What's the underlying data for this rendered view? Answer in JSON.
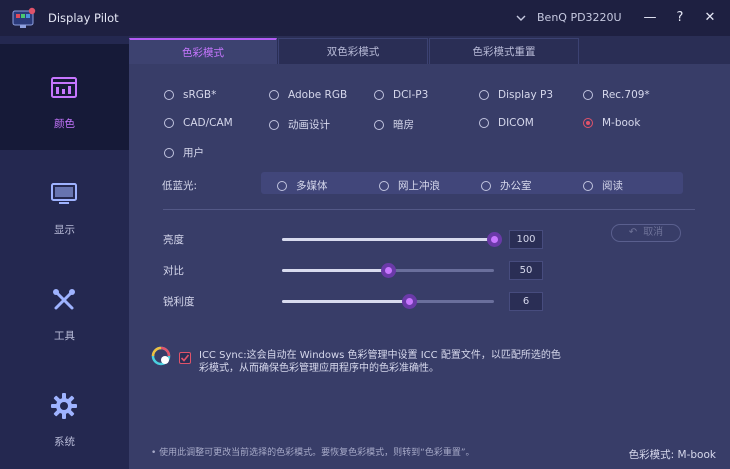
{
  "app": {
    "title": "Display Pilot",
    "monitor": "BenQ PD3220U"
  },
  "window_controls": {
    "minimize": "—",
    "help": "?",
    "close": "✕"
  },
  "sidebar": {
    "items": [
      {
        "label": "颜色",
        "icon": "color-chart-icon",
        "active": true
      },
      {
        "label": "显示",
        "icon": "monitor-icon",
        "active": false
      },
      {
        "label": "工具",
        "icon": "tools-icon",
        "active": false
      },
      {
        "label": "系统",
        "icon": "gear-icon",
        "active": false
      }
    ]
  },
  "tabs": [
    {
      "label": "色彩模式",
      "active": true
    },
    {
      "label": "双色彩模式",
      "active": false
    },
    {
      "label": "色彩模式重置",
      "active": false
    }
  ],
  "color_modes": {
    "options": [
      "sRGB*",
      "Adobe RGB",
      "DCI-P3",
      "Display P3",
      "Rec.709*",
      "CAD/CAM",
      "动画设计",
      "暗房",
      "DICOM",
      "M-book",
      "用户"
    ],
    "selected": "M-book"
  },
  "low_blue_light": {
    "label": "低蓝光:",
    "options": [
      "多媒体",
      "网上冲浪",
      "办公室",
      "阅读"
    ]
  },
  "sliders": [
    {
      "label": "亮度",
      "value": 100,
      "max": 100
    },
    {
      "label": "对比",
      "value": 50,
      "max": 100
    },
    {
      "label": "锐利度",
      "value": 6,
      "max": 10
    }
  ],
  "cancel_button": {
    "label": "取消"
  },
  "icc_sync": {
    "checked": true,
    "text": "ICC Sync:这会自动在 Windows 色彩管理中设置 ICC 配置文件，以匹配所选的色彩模式，从而确保色彩管理应用程序中的色彩准确性。"
  },
  "footer": {
    "note": "• 使用此调整可更改当前选择的色彩模式。要恢复色彩模式，则转到“色彩重置”。",
    "mode_label": "色彩模式: M-book"
  },
  "colors": {
    "accent": "#c776ff",
    "selected": "#e0536a",
    "sidebar": "#242850",
    "panel": "#383d68"
  }
}
